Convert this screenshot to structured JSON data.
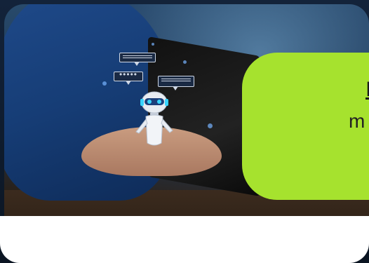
{
  "callout": {
    "title_fragment": "I",
    "body_fragment": "m"
  },
  "colors": {
    "callout_bg": "#a6e22e",
    "shirt": "#1f4a8a",
    "card_frame": "#ffffff"
  },
  "icons": [
    "robot-icon",
    "chat-bubble-icon"
  ]
}
